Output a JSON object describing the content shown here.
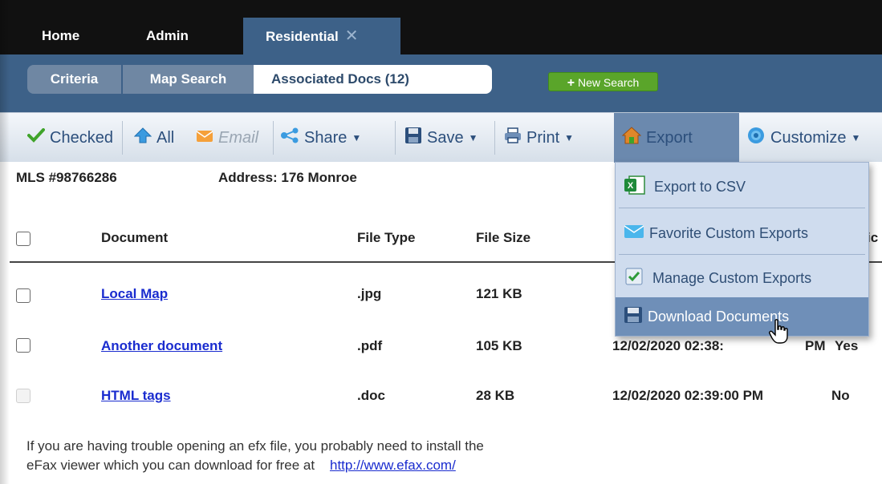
{
  "nav": {
    "tabs": [
      "Home",
      "Admin",
      "Residential"
    ],
    "close_glyph": "✕"
  },
  "subnav": {
    "tabs": [
      "Criteria",
      "Map Search",
      "Associated Docs (12)"
    ],
    "new_search": "New Search"
  },
  "toolbar": {
    "checked": "Checked",
    "all": "All",
    "email": "Email",
    "share": "Share",
    "save": "Save",
    "print": "Print",
    "export": "Export",
    "customize": "Customize"
  },
  "export_menu": {
    "items": [
      "Export to CSV",
      "Favorite Custom Exports",
      "Manage Custom Exports",
      "Download Documents"
    ],
    "hovered": "Download Documents"
  },
  "listing": {
    "mls": "MLS #98766286",
    "address": "Address: 176 Monroe"
  },
  "table": {
    "headers": [
      "Document",
      "File Type",
      "File Size"
    ],
    "partial_header_right": "ic",
    "rows": [
      {
        "document": "Local Map",
        "type": ".jpg",
        "size": "121 KB",
        "date": "",
        "flag": "",
        "checkbox_enabled": true
      },
      {
        "document": "Another document",
        "type": ".pdf",
        "size": "105 KB",
        "date": "12/02/2020 02:38:",
        "date_tail": "PM",
        "flag": "Yes",
        "checkbox_enabled": true
      },
      {
        "document": "HTML tags",
        "type": ".doc",
        "size": "28 KB",
        "date": "12/02/2020 02:39:00 PM",
        "flag": "No",
        "checkbox_enabled": false
      }
    ]
  },
  "note": {
    "line1": "If you are having trouble opening an efx file, you probably need to install the",
    "line2": "eFax viewer which you can download for free at",
    "link": "http://www.efax.com/"
  },
  "colors": {
    "nav_bg": "#111111",
    "accent": "#3d6188",
    "link": "#1a2ccf",
    "new_search": "#5aa52a",
    "menu_bg": "#cfdcee",
    "menu_hover": "#6f8fb8"
  }
}
